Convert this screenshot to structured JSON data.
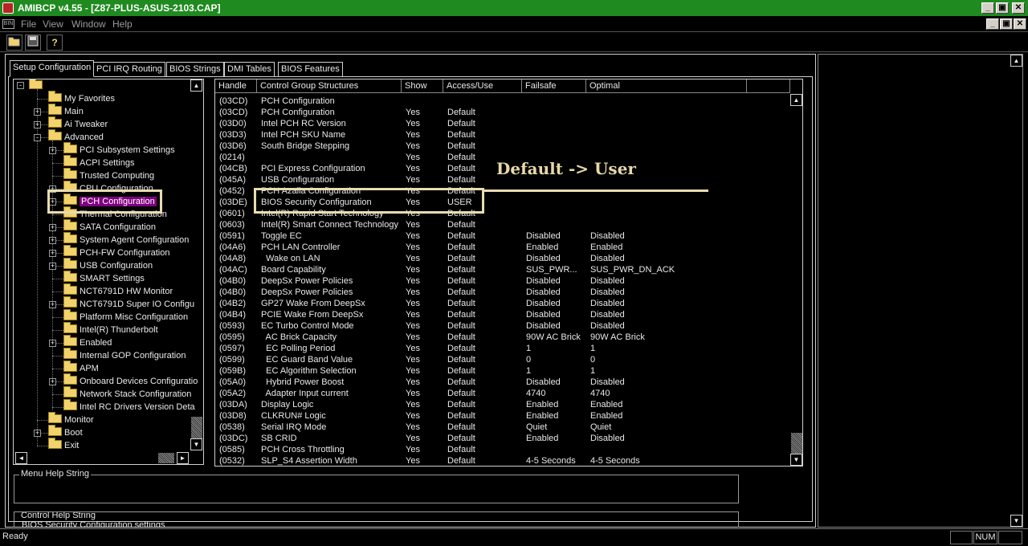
{
  "window": {
    "title": "AMIBCP v4.55 - [Z87-PLUS-ASUS-2103.CAP]",
    "min": "_",
    "restore": "▣",
    "close": "✕"
  },
  "menu": {
    "items": [
      "File",
      "View",
      "Window",
      "Help"
    ]
  },
  "toolbar": {
    "buttons": [
      "open-folder-icon",
      "save-icon",
      "help-icon"
    ]
  },
  "tabs": [
    "Setup Configuration",
    "PCI IRQ Routing",
    "BIOS Strings",
    "DMI Tables",
    "BIOS Features"
  ],
  "tree": [
    {
      "label": "My Favorites",
      "level": 1,
      "exp": ""
    },
    {
      "label": "Main",
      "level": 1,
      "exp": "+"
    },
    {
      "label": "Ai Tweaker",
      "level": 1,
      "exp": "+"
    },
    {
      "label": "Advanced",
      "level": 1,
      "exp": "-"
    },
    {
      "label": "PCI Subsystem Settings",
      "level": 2,
      "exp": "+"
    },
    {
      "label": "ACPI Settings",
      "level": 2,
      "exp": ""
    },
    {
      "label": "Trusted Computing",
      "level": 2,
      "exp": ""
    },
    {
      "label": "CPU Configuration",
      "level": 2,
      "exp": "+"
    },
    {
      "label": "PCH Configuration",
      "level": 2,
      "exp": "+",
      "selected": true
    },
    {
      "label": "Thermal Configuration",
      "level": 2,
      "exp": ""
    },
    {
      "label": "SATA Configuration",
      "level": 2,
      "exp": "+"
    },
    {
      "label": "System Agent Configuration",
      "level": 2,
      "exp": "+"
    },
    {
      "label": "PCH-FW Configuration",
      "level": 2,
      "exp": "+"
    },
    {
      "label": "USB Configuration",
      "level": 2,
      "exp": "+"
    },
    {
      "label": "SMART Settings",
      "level": 2,
      "exp": ""
    },
    {
      "label": "NCT6791D HW Monitor",
      "level": 2,
      "exp": ""
    },
    {
      "label": "NCT6791D Super IO Configu",
      "level": 2,
      "exp": "+"
    },
    {
      "label": "Platform Misc Configuration",
      "level": 2,
      "exp": ""
    },
    {
      "label": "Intel(R) Thunderbolt",
      "level": 2,
      "exp": ""
    },
    {
      "label": "Enabled",
      "level": 2,
      "exp": "+"
    },
    {
      "label": "Internal GOP Configuration",
      "level": 2,
      "exp": ""
    },
    {
      "label": "APM",
      "level": 2,
      "exp": ""
    },
    {
      "label": "Onboard Devices Configuratio",
      "level": 2,
      "exp": "+"
    },
    {
      "label": "Network Stack Configuration",
      "level": 2,
      "exp": ""
    },
    {
      "label": "Intel RC Drivers Version Deta",
      "level": 2,
      "exp": ""
    },
    {
      "label": "Monitor",
      "level": 1,
      "exp": ""
    },
    {
      "label": "Boot",
      "level": 1,
      "exp": "+"
    },
    {
      "label": "Exit",
      "level": 1,
      "exp": ""
    }
  ],
  "grid": {
    "columns": [
      "Handle",
      "Control Group Structures",
      "Show",
      "Access/Use",
      "Failsafe",
      "Optimal"
    ],
    "rows": [
      [
        "(03CD)",
        "PCH Configuration",
        "",
        "",
        "",
        ""
      ],
      [
        "(03CD)",
        "PCH Configuration",
        "Yes",
        "Default",
        "",
        ""
      ],
      [
        "(03D0)",
        "Intel PCH RC Version",
        "Yes",
        "Default",
        "",
        ""
      ],
      [
        "(03D3)",
        "Intel PCH SKU Name",
        "Yes",
        "Default",
        "",
        ""
      ],
      [
        "(03D6)",
        "South Bridge Stepping",
        "Yes",
        "Default",
        "",
        ""
      ],
      [
        "(0214)",
        "",
        "Yes",
        "Default",
        "",
        ""
      ],
      [
        "(04CB)",
        "PCI Express Configuration",
        "Yes",
        "Default",
        "",
        ""
      ],
      [
        "(045A)",
        "USB Configuration",
        "Yes",
        "Default",
        "",
        ""
      ],
      [
        "(0452)",
        "PCH Azalia Configuration",
        "Yes",
        "Default",
        "",
        ""
      ],
      [
        "(03DE)",
        "BIOS Security Configuration",
        "Yes",
        "USER",
        "",
        ""
      ],
      [
        "(0601)",
        "Intel(R) Rapid Start Technology",
        "Yes",
        "Default",
        "",
        ""
      ],
      [
        "(0603)",
        "Intel(R) Smart Connect Technology",
        "Yes",
        "Default",
        "",
        ""
      ],
      [
        "(0591)",
        "Toggle EC",
        "Yes",
        "Default",
        "Disabled",
        "Disabled"
      ],
      [
        "(04A6)",
        "PCH LAN Controller",
        "Yes",
        "Default",
        "Enabled",
        "Enabled"
      ],
      [
        "(04A8)",
        "  Wake on LAN",
        "Yes",
        "Default",
        "Disabled",
        "Disabled"
      ],
      [
        "(04AC)",
        "Board Capability",
        "Yes",
        "Default",
        "SUS_PWR...",
        "SUS_PWR_DN_ACK"
      ],
      [
        "(04B0)",
        "DeepSx Power Policies",
        "Yes",
        "Default",
        "Disabled",
        "Disabled"
      ],
      [
        "(04B0)",
        "DeepSx Power Policies",
        "Yes",
        "Default",
        "Disabled",
        "Disabled"
      ],
      [
        "(04B2)",
        "GP27 Wake From DeepSx",
        "Yes",
        "Default",
        "Disabled",
        "Disabled"
      ],
      [
        "(04B4)",
        "PCIE Wake From DeepSx",
        "Yes",
        "Default",
        "Disabled",
        "Disabled"
      ],
      [
        "(0593)",
        "EC Turbo Control Mode",
        "Yes",
        "Default",
        "Disabled",
        "Disabled"
      ],
      [
        "(0595)",
        "  AC Brick Capacity",
        "Yes",
        "Default",
        "90W AC Brick",
        "90W AC Brick"
      ],
      [
        "(0597)",
        "  EC Polling Period",
        "Yes",
        "Default",
        "1",
        "1"
      ],
      [
        "(0599)",
        "  EC Guard Band Value",
        "Yes",
        "Default",
        "0",
        "0"
      ],
      [
        "(059B)",
        "  EC Algorithm Selection",
        "Yes",
        "Default",
        "1",
        "1"
      ],
      [
        "(05A0)",
        "  Hybrid Power Boost",
        "Yes",
        "Default",
        "Disabled",
        "Disabled"
      ],
      [
        "(05A2)",
        "  Adapter Input current",
        "Yes",
        "Default",
        "4740",
        "4740"
      ],
      [
        "(03DA)",
        "Display Logic",
        "Yes",
        "Default",
        "Enabled",
        "Enabled"
      ],
      [
        "(03D8)",
        "CLKRUN# Logic",
        "Yes",
        "Default",
        "Enabled",
        "Enabled"
      ],
      [
        "(0538)",
        "Serial IRQ Mode",
        "Yes",
        "Default",
        "Quiet",
        "Quiet"
      ],
      [
        "(03DC)",
        "SB CRID",
        "Yes",
        "Default",
        "Enabled",
        "Disabled"
      ],
      [
        "(0585)",
        "PCH Cross Throttling",
        "Yes",
        "Default",
        "",
        ""
      ],
      [
        "(0532)",
        "SLP_S4 Assertion Width",
        "Yes",
        "Default",
        "4-5 Seconds",
        "4-5 Seconds"
      ]
    ]
  },
  "help": {
    "menu_label": "Menu Help String",
    "control_label": "Control Help String",
    "control_text": "BIOS Security Configuration settings"
  },
  "status": {
    "text": "Ready",
    "num": "NUM"
  },
  "annotation": {
    "text": "Default -> User"
  }
}
